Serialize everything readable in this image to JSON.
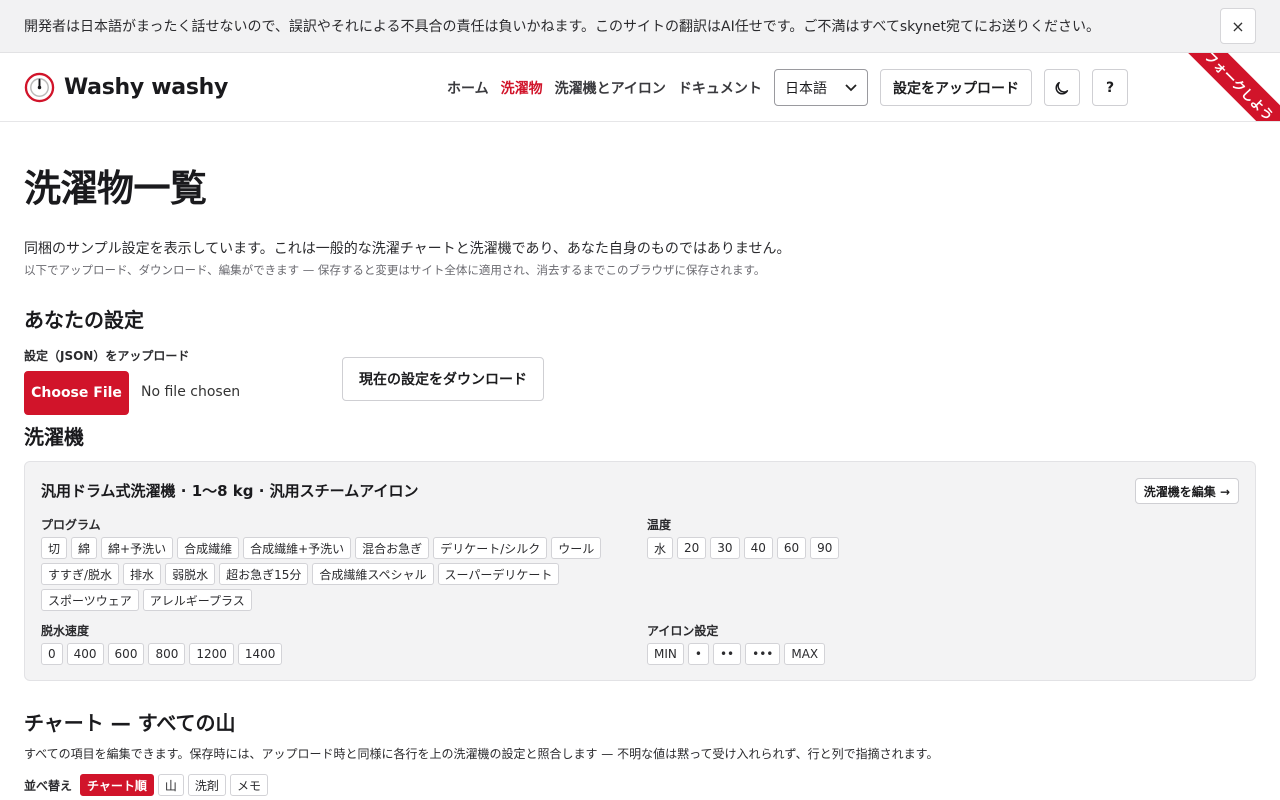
{
  "banner": {
    "text": "開発者は日本語がまったく話せないので、誤訳やそれによる不具合の責任は負いかねます。このサイトの翻訳はAI任せです。ご不満はすべてskynet宛てにお送りください。",
    "close_icon": "×"
  },
  "header": {
    "brand": "Washy washy",
    "nav": [
      "ホーム",
      "洗濯物",
      "洗濯機とアイロン",
      "ドキュメント"
    ],
    "active_nav_index": 1,
    "language": "日本語",
    "upload_settings": "設定をアップロード",
    "theme_icon": "moon-icon",
    "help": "?",
    "ribbon": "フォークしよう"
  },
  "main": {
    "title": "洗濯物一覧",
    "intro": "同梱のサンプル設定を表示しています。これは一般的な洗濯チャートと洗濯機であり、あなた自身のものではありません。",
    "intro_sub": "以下でアップロード、ダウンロード、編集ができます — 保存すると変更はサイト全体に適用され、消去するまでこのブラウザに保存されます。",
    "settings_heading": "あなたの設定",
    "upload_label": "設定（JSON）をアップロード",
    "choose_file": "Choose File",
    "no_file": "No file chosen",
    "download": "現在の設定をダウンロード",
    "machine_heading": "洗濯機",
    "machine": {
      "title": "汎用ドラム式洗濯機 · 1〜8 kg · 汎用スチームアイロン",
      "edit": "洗濯機を編集 →",
      "programs_label": "プログラム",
      "programs": [
        "切",
        "綿",
        "綿+予洗い",
        "合成繊維",
        "合成繊維+予洗い",
        "混合お急ぎ",
        "デリケート/シルク",
        "ウール",
        "すすぎ/脱水",
        "排水",
        "弱脱水",
        "超お急ぎ15分",
        "合成繊維スペシャル",
        "スーパーデリケート",
        "スポーツウェア",
        "アレルギープラス"
      ],
      "temps_label": "温度",
      "temps": [
        "水",
        "20",
        "30",
        "40",
        "60",
        "90"
      ],
      "spin_label": "脱水速度",
      "spins": [
        "0",
        "400",
        "600",
        "800",
        "1200",
        "1400"
      ],
      "iron_label": "アイロン設定",
      "irons": [
        "MIN",
        "•",
        "••",
        "•••",
        "MAX"
      ]
    },
    "chart_heading": "チャート — すべての山",
    "chart_desc": "すべての項目を編集できます。保存時には、アップロード時と同様に各行を上の洗濯機の設定と照合します — 不明な値は黙って受け入れられず、行と列で指摘されます。",
    "sort_label": "並べ替え",
    "sort_options": [
      "チャート順",
      "山",
      "洗剤",
      "メモ"
    ],
    "sort_active_index": 0
  },
  "colors": {
    "accent": "#d1142a"
  }
}
